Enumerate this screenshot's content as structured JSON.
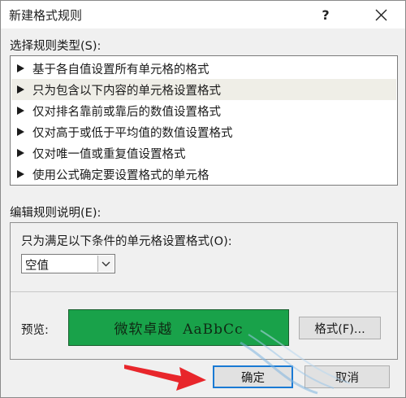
{
  "dialog": {
    "title": "新建格式规则",
    "help_label": "?",
    "close_icon": "close-icon"
  },
  "rule_type": {
    "label": "选择规则类型(S):",
    "items": [
      {
        "label": "基于各自值设置所有单元格的格式",
        "selected": false
      },
      {
        "label": "只为包含以下内容的单元格设置格式",
        "selected": true
      },
      {
        "label": "仅对排名靠前或靠后的数值设置格式",
        "selected": false
      },
      {
        "label": "仅对高于或低于平均值的数值设置格式",
        "selected": false
      },
      {
        "label": "仅对唯一值或重复值设置格式",
        "selected": false
      },
      {
        "label": "使用公式确定要设置格式的单元格",
        "selected": false
      }
    ]
  },
  "rule_desc": {
    "label": "编辑规则说明(E):",
    "condition_label": "只为满足以下条件的单元格设置格式(O):",
    "condition_value": "空值",
    "preview_label": "预览:",
    "preview_text": "微软卓越  AaBbCc",
    "preview_color": "#19a24a",
    "format_button": "格式(F)..."
  },
  "footer": {
    "ok_label": "确定",
    "cancel_label": "取消"
  },
  "annotation": {
    "arrow_color": "#e8262b"
  }
}
